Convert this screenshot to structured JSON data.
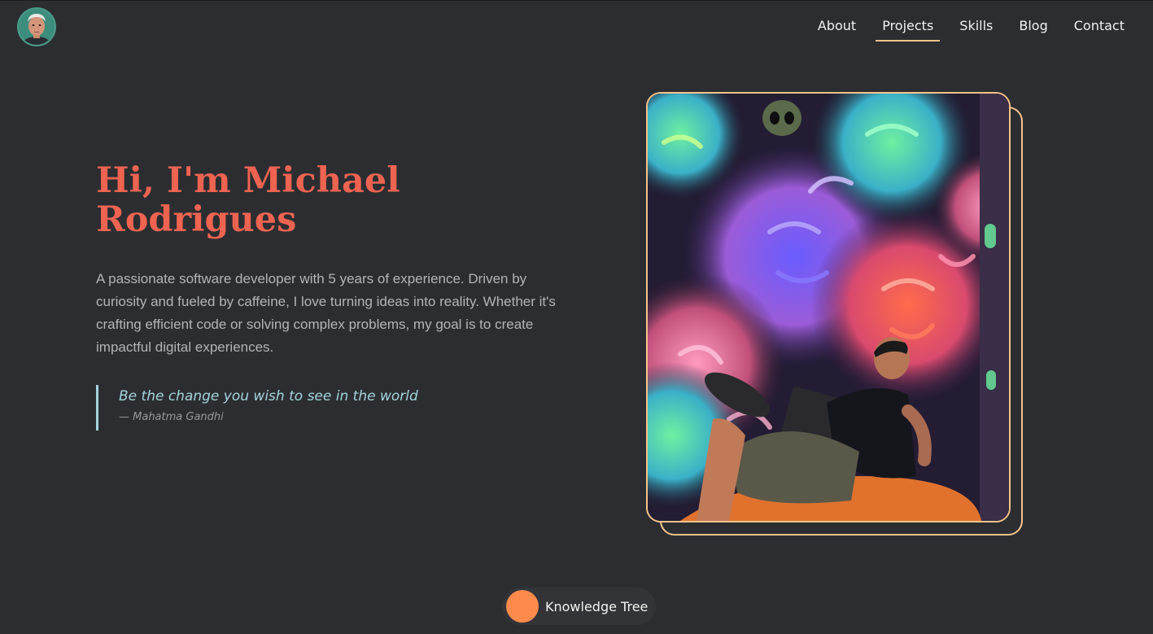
{
  "header": {
    "avatar_icon": "profile-avatar",
    "nav": [
      {
        "label": "About",
        "active": false
      },
      {
        "label": "Projects",
        "active": true
      },
      {
        "label": "Skills",
        "active": false
      },
      {
        "label": "Blog",
        "active": false
      },
      {
        "label": "Contact",
        "active": false
      }
    ]
  },
  "hero": {
    "title_line1": "Hi, I'm Michael",
    "title_line2": "Rodrigues",
    "bio": "A passionate software developer with 5 years of experience. Driven by curiosity and fueled by caffeine, I love turning ideas into reality. Whether it's crafting efficient code or solving complex problems, my goal is to create impactful digital experiences.",
    "quote": {
      "text": "Be the change you wish to see in the world",
      "author": "— Mahatma Gandhi"
    },
    "photo_icon": "portrait-photo"
  },
  "footer": {
    "knowledge_tree_label": "Knowledge Tree"
  },
  "colors": {
    "background": "#2c2d31",
    "title": "#ef6351",
    "accent_border": "#f6c48a",
    "quote": "#a3d4dc",
    "pill_dot": "#ff8a4c"
  }
}
